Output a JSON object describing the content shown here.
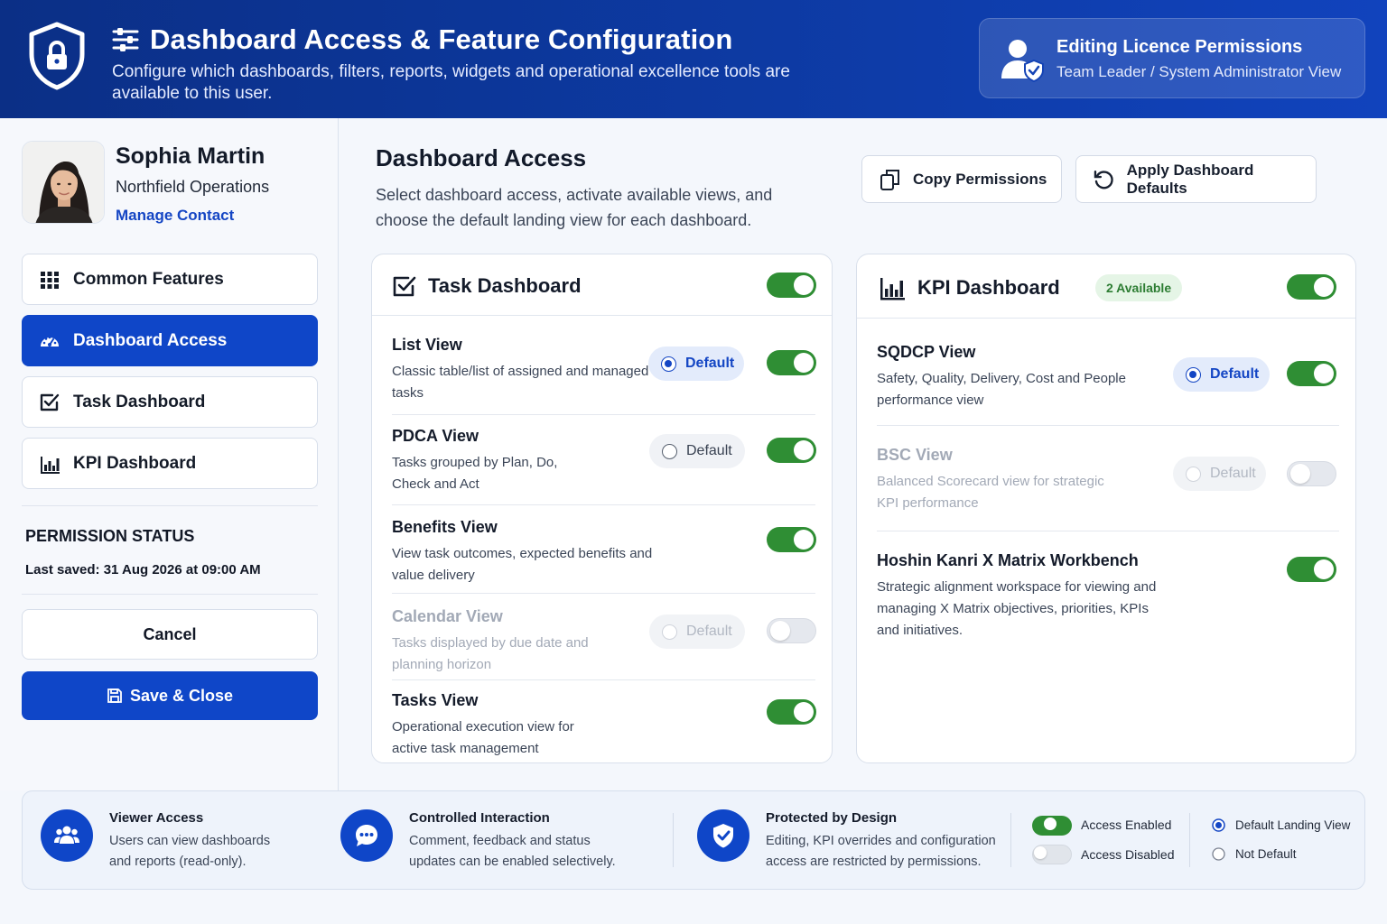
{
  "colors": {
    "primary": "#0f46c8",
    "header": "#0d3aa3",
    "toggle_on": "#2f8e34",
    "badge_bg": "#e5f5e6"
  },
  "header": {
    "title": "Dashboard Access & Feature Configuration",
    "subtitle": "Configure which dashboards, filters, reports, widgets and operational excellence tools are available to this user.",
    "edit_title": "Editing Licence Permissions",
    "edit_subtitle": "Team Leader / System Administrator View"
  },
  "user": {
    "name": "Sophia Martin",
    "org": "Northfield Operations",
    "link": "Manage Contact"
  },
  "sidebar": {
    "items": [
      {
        "label": "Common Features",
        "icon": "grid-icon"
      },
      {
        "label": "Dashboard Access",
        "icon": "gauge-icon"
      },
      {
        "label": "Task Dashboard",
        "icon": "checkbox-icon"
      },
      {
        "label": "KPI Dashboard",
        "icon": "bar-chart-icon"
      }
    ],
    "status_title": "PERMISSION STATUS",
    "last_saved": "Last saved: 31 Aug 2026 at 09:00 AM",
    "cancel": "Cancel",
    "save": "Save & Close"
  },
  "main": {
    "title": "Dashboard Access",
    "subtitle": "Select dashboard access, activate available views, and choose the default landing view for each dashboard.",
    "copy_btn": "Copy Permissions",
    "defaults_btn": "Apply Dashboard Defaults"
  },
  "task": {
    "title": "Task Dashboard",
    "enabled": true,
    "views": [
      {
        "title": "List View",
        "desc": "Classic table/list of assigned and managed tasks",
        "default_label": "Default",
        "is_default": true,
        "enabled": true
      },
      {
        "title": "PDCA View",
        "desc": "Tasks grouped by Plan, Do, Check and Act",
        "default_label": "Default",
        "is_default": false,
        "enabled": true
      },
      {
        "title": "Benefits View",
        "desc": "View task outcomes, expected benefits and value delivery",
        "enabled": true
      },
      {
        "title": "Calendar View",
        "desc": "Tasks displayed by due date and planning horizon",
        "default_label": "Default",
        "is_default": false,
        "enabled": false
      },
      {
        "title": "Tasks View",
        "desc": "Operational execution view for active task management",
        "enabled": true
      }
    ]
  },
  "kpi": {
    "title": "KPI Dashboard",
    "badge": "2 Available",
    "enabled": true,
    "views": [
      {
        "title": "SQDCP View",
        "desc": "Safety, Quality, Delivery, Cost and People performance view",
        "default_label": "Default",
        "is_default": true,
        "enabled": true
      },
      {
        "title": "BSC View",
        "desc": "Balanced Scorecard view for strategic KPI performance",
        "default_label": "Default",
        "is_default": false,
        "enabled": false
      },
      {
        "title": "Hoshin Kanri X Matrix Workbench",
        "desc": "Strategic alignment workspace for viewing and managing X Matrix objectives, priorities, KPIs and initiatives.",
        "enabled": true
      }
    ]
  },
  "footer": {
    "items": [
      {
        "title": "Viewer Access",
        "desc": "Users can view dashboards and reports (read-only).",
        "icon": "users-icon"
      },
      {
        "title": "Controlled Interaction",
        "desc": "Comment, feedback and status updates can be enabled selectively.",
        "icon": "chat-icon"
      },
      {
        "title": "Protected by Design",
        "desc": "Editing, KPI overrides and configuration access are restricted by permissions.",
        "icon": "shield-check-icon"
      }
    ],
    "legend": {
      "enabled": "Access Enabled",
      "disabled": "Access Disabled",
      "default": "Default Landing View",
      "not_default": "Not Default"
    }
  }
}
